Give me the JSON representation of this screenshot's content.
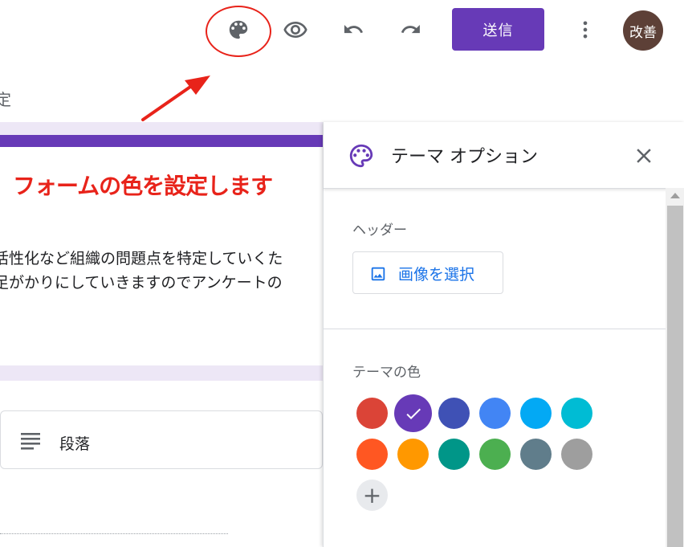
{
  "toolbar": {
    "icons": [
      "palette-icon",
      "preview-eye-icon",
      "undo-icon",
      "redo-icon",
      "more-vert-icon"
    ],
    "send_label": "送信",
    "avatar_text": "改善",
    "partial_char": "定"
  },
  "annotation": {
    "text": "フォームの色を設定します",
    "color": "#e8231a"
  },
  "form": {
    "description_lines": [
      "活性化など組織の問題点を特定していくた",
      "足がかりにしていきますのでアンケートの"
    ],
    "question_type": "段落"
  },
  "theme_panel": {
    "title": "テーマ オプション",
    "header_label": "ヘッダー",
    "image_button_label": "画像を選択",
    "theme_color_label": "テーマの色",
    "colors": [
      "#db4437",
      "#673ab7",
      "#3f51b5",
      "#4285f4",
      "#03a9f4",
      "#00bcd4",
      "#ff5722",
      "#ff9800",
      "#009688",
      "#4caf50",
      "#607d8b",
      "#9e9e9e"
    ],
    "selected_color": "#673ab7",
    "add_color_label": "+"
  },
  "colors": {
    "accent": "#673ab7",
    "form_background": "#ede7f6",
    "link_blue": "#1a73e8"
  }
}
